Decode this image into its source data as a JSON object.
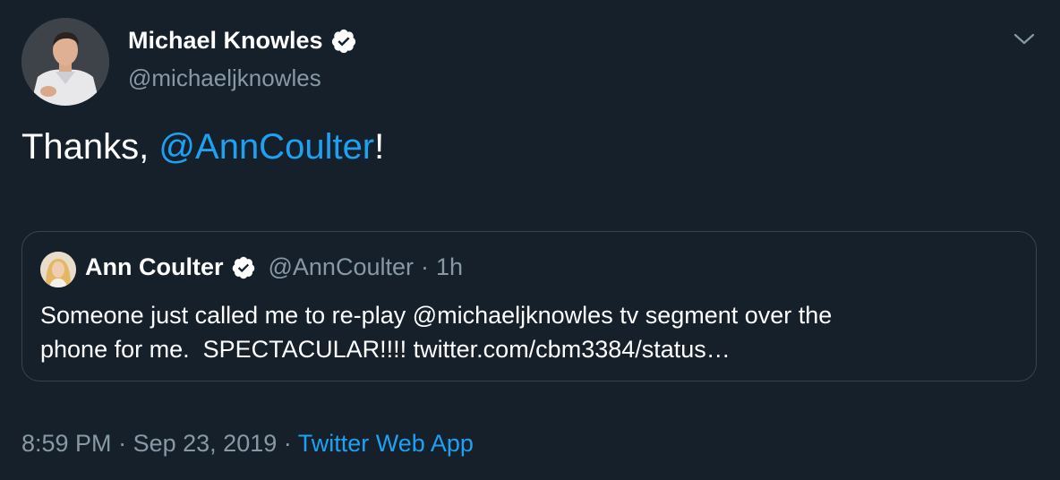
{
  "author": {
    "name": "Michael Knowles",
    "handle": "@michaeljknowles",
    "verified": true
  },
  "tweet": {
    "text_prefix": "Thanks, ",
    "mention": "@AnnCoulter",
    "text_suffix": "!"
  },
  "quote": {
    "name": "Ann Coulter",
    "handle": "@AnnCoulter",
    "separator": "·",
    "time": "1h",
    "text": "Someone just called me to re-play @michaeljknowles tv segment over the\nphone for me.  SPECTACULAR!!!! twitter.com/cbm3384/status…"
  },
  "meta": {
    "time": "8:59 PM",
    "separator1": "·",
    "date": "Sep 23, 2019",
    "separator2": "·",
    "source": "Twitter Web App"
  },
  "icons": {
    "verified": "verified-badge-icon",
    "caret": "chevron-down-icon"
  },
  "colors": {
    "background": "#15202b",
    "accent": "#1da1f2",
    "muted": "#8899a6",
    "border": "#38444d"
  }
}
